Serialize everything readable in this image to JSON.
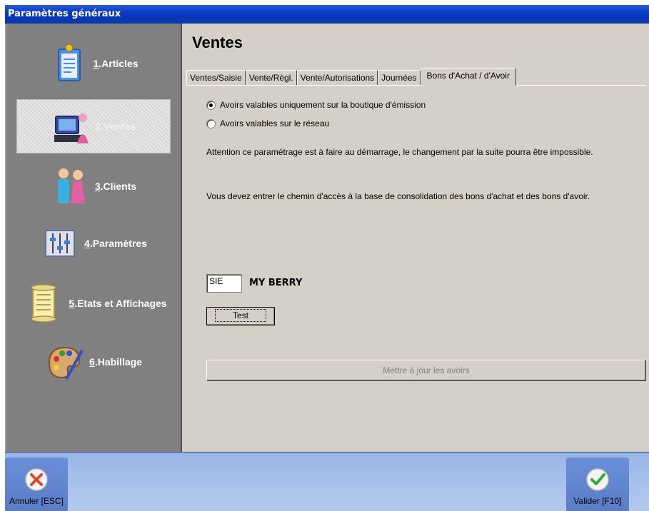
{
  "window": {
    "title": "Paramètres généraux"
  },
  "sidebar": {
    "items": [
      {
        "num": "1",
        "label": ".Articles",
        "icon": "clipboard-icon"
      },
      {
        "num": "2",
        "label": ".Ventes",
        "icon": "cash-register-icon",
        "active": true
      },
      {
        "num": "3",
        "label": ".Clients",
        "icon": "people-icon"
      },
      {
        "num": "4",
        "label": ".Paramètres",
        "icon": "sliders-icon"
      },
      {
        "num": "5",
        "label": ".Etats et Affichages",
        "icon": "scroll-icon"
      },
      {
        "num": "6",
        "label": ".Habillage",
        "icon": "palette-icon"
      }
    ]
  },
  "main": {
    "title": "Ventes",
    "tabs": [
      {
        "label": "Ventes/Saisie"
      },
      {
        "label": "Vente/Règl."
      },
      {
        "label": "Vente/Autorisations"
      },
      {
        "label": "Journées"
      },
      {
        "label": "Bons d'Achat / d'Avoir",
        "selected": true
      }
    ],
    "radio_local": {
      "label": "Avoirs valables uniquement sur la boutique d'émission",
      "checked": true
    },
    "radio_network": {
      "label": "Avoirs valables sur le réseau",
      "checked": false
    },
    "warning_text": "Attention ce paramétrage est à faire au démarrage, le changement par la suite pourra être impossible.",
    "path_prompt": "Vous devez entrer le chemin d'accès à la base de consolidation des bons d'achat et des bons d'avoir.",
    "code_value": "SIE",
    "base_name": "MY BERRY",
    "test_label": "Test",
    "update_label": "Mettre à jour les avoirs"
  },
  "bottom": {
    "cancel_label": "Annuler [ESC]",
    "validate_label": "Valider [F10]"
  },
  "colors": {
    "titlebar": "#0a3cc4",
    "sidebar": "#808080",
    "panel": "#d4d0c8",
    "bottombar": "#a8c0ec",
    "cancel_red": "#d84a2a",
    "validate_green": "#3aa838"
  }
}
